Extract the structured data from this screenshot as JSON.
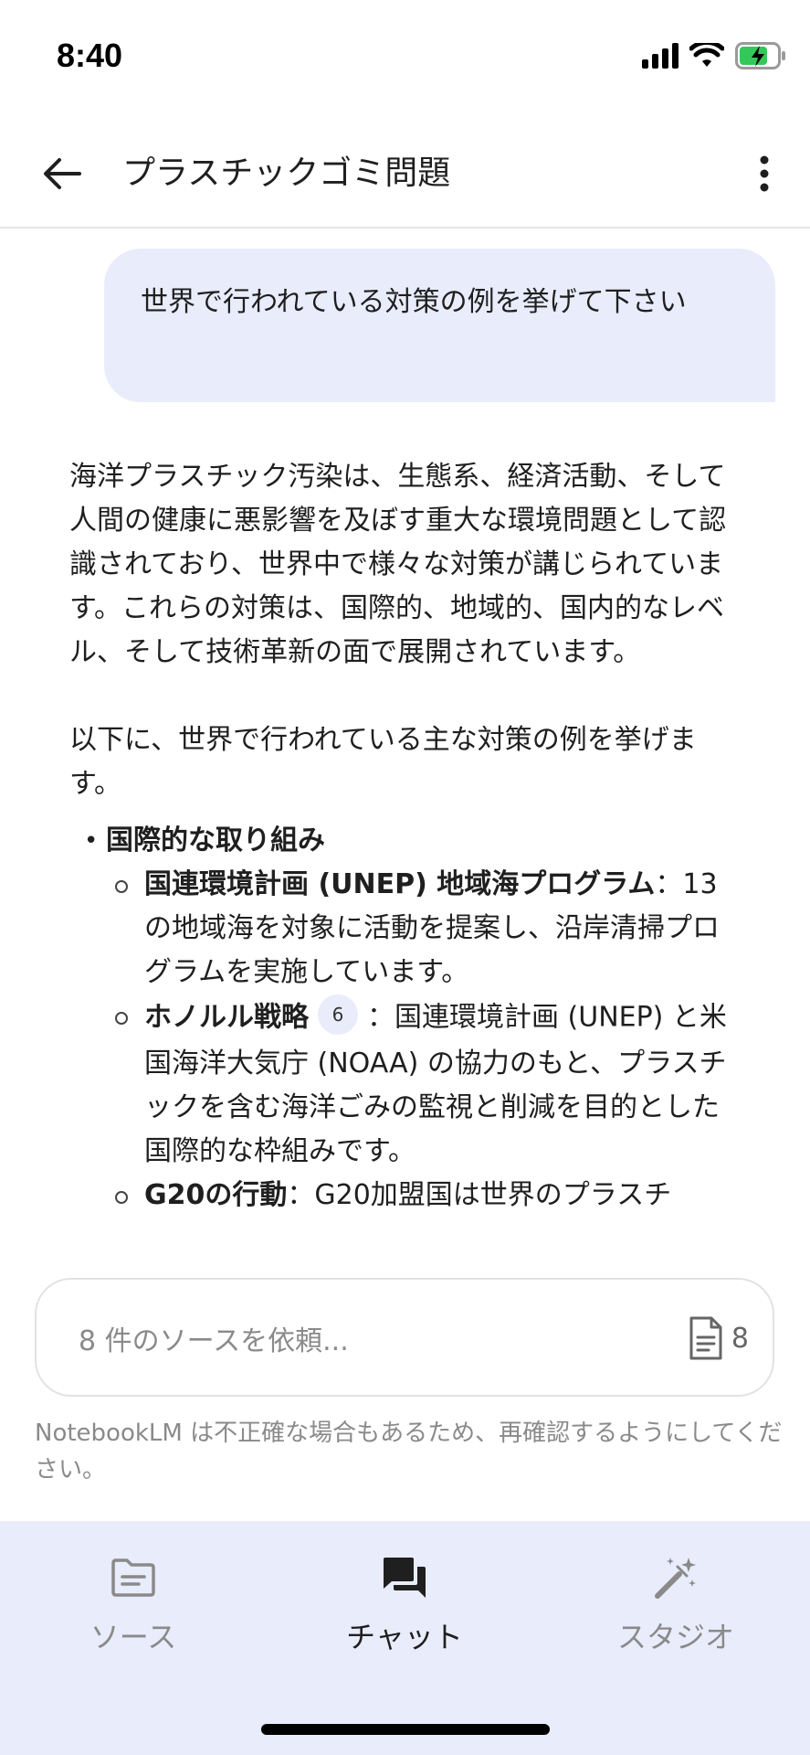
{
  "status_bar": {
    "time": "8:40"
  },
  "header": {
    "title": "プラスチックゴミ問題"
  },
  "chat": {
    "user_message": "世界で行われている対策の例を挙げて下さい",
    "answer": {
      "intro": "海洋プラスチック汚染は、生態系、経済活動、そして人間の健康に悪影響を及ぼす重大な環境問題として認識されており、世界中で様々な対策が講じられています。これらの対策は、国際的、地域的、国内的なレベル、そして技術革新の面で展開されています。",
      "lead": "以下に、世界で行われている主な対策の例を挙げます。",
      "sections": [
        {
          "heading": "国際的な取り組み",
          "items": [
            {
              "title": "国連環境計画 (UNEP) 地域海プログラム",
              "sep": "：",
              "text": "13の地域海を対象に活動を提案し、沿岸清掃プログラムを実施しています。"
            },
            {
              "title": "ホノルル戦略",
              "cite": "6",
              "sep": "：",
              "text": "国連環境計画 (UNEP) と米国海洋大気庁 (NOAA) の協力のもと、プラスチックを含む海洋ごみの監視と削減を目的とした国際的な枠組みです。"
            },
            {
              "title": "G20の行動",
              "sep": "：",
              "text": "G20加盟国は世界のプラスチ"
            }
          ]
        }
      ]
    }
  },
  "input": {
    "placeholder": "8 件のソースを依頼...",
    "source_count": "8"
  },
  "disclaimer": "NotebookLM は不正確な場合もあるため、再確認するようにしてください。",
  "nav": {
    "sources": "ソース",
    "chat": "チャット",
    "studio": "スタジオ"
  }
}
